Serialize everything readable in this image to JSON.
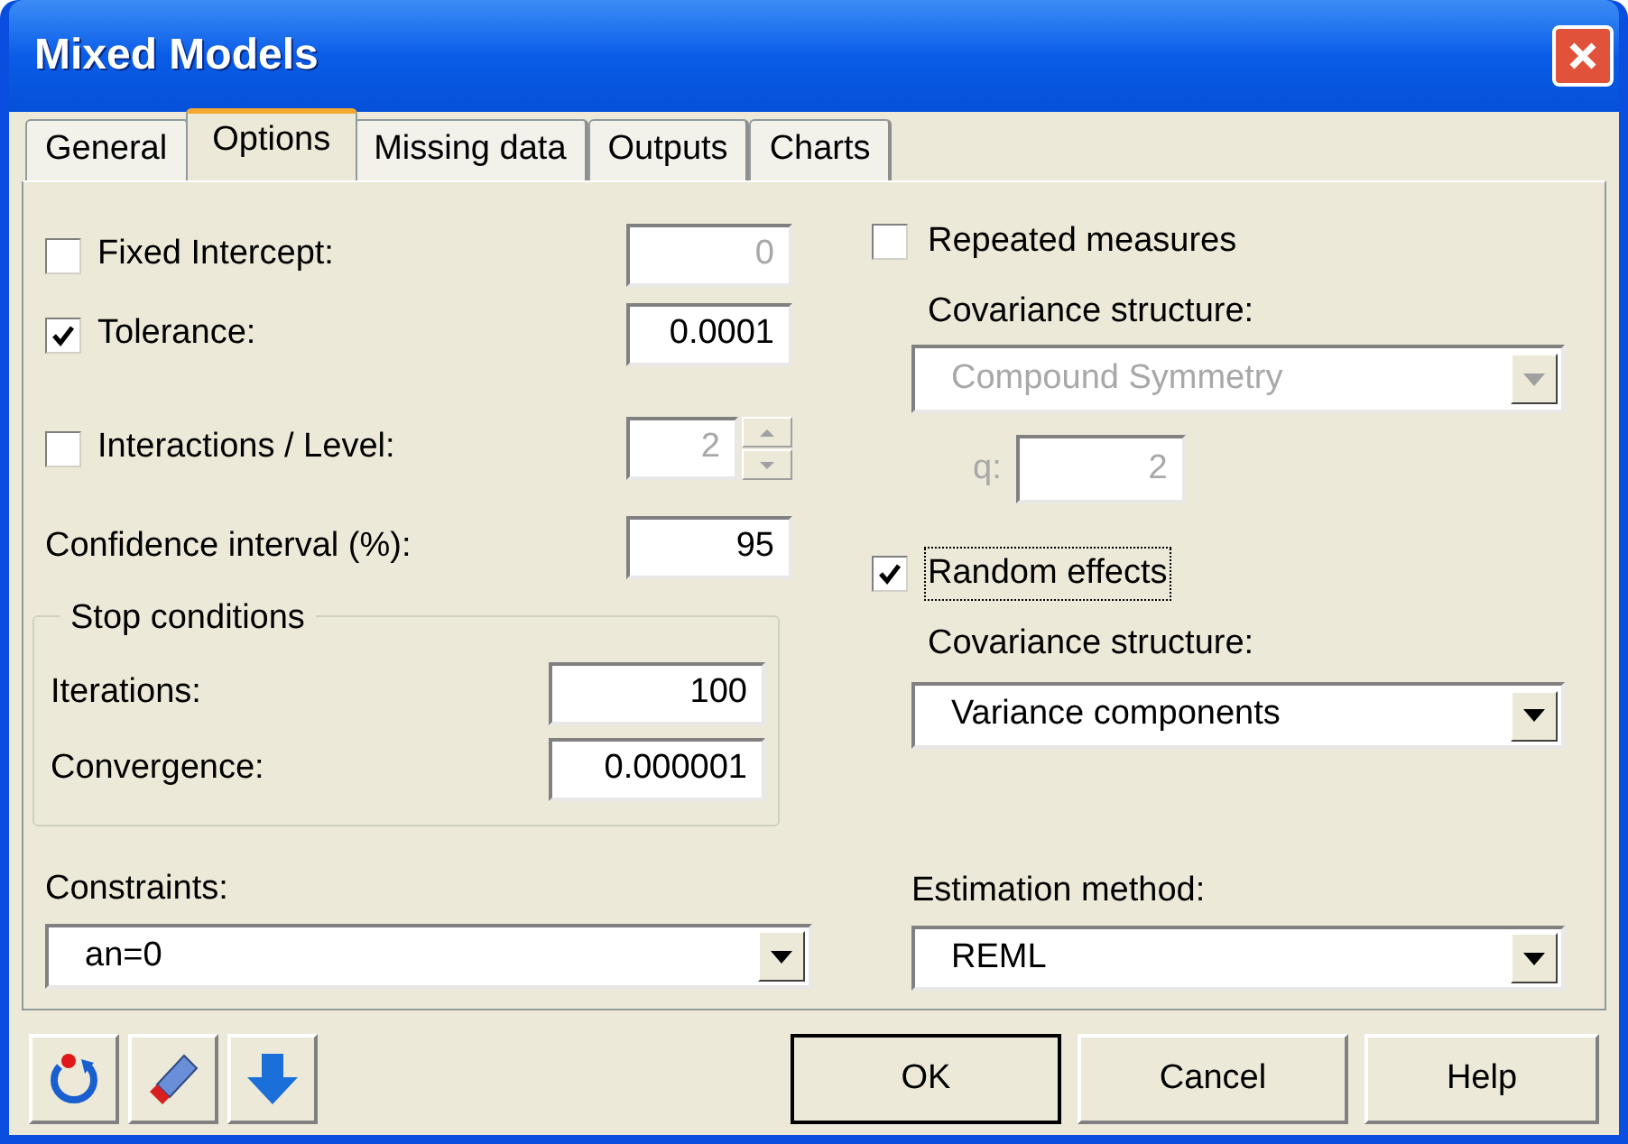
{
  "window": {
    "title": "Mixed Models"
  },
  "tabs": [
    {
      "label": "General",
      "selected": false
    },
    {
      "label": "Options",
      "selected": true
    },
    {
      "label": "Missing data",
      "selected": false
    },
    {
      "label": "Outputs",
      "selected": false
    },
    {
      "label": "Charts",
      "selected": false
    }
  ],
  "fixed_intercept": {
    "label": "Fixed Intercept:",
    "checked": false,
    "value": "0",
    "disabled": true
  },
  "tolerance": {
    "label": "Tolerance:",
    "checked": true,
    "value": "0.0001",
    "disabled": false
  },
  "interactions": {
    "label": "Interactions / Level:",
    "checked": false,
    "value": "2",
    "disabled": true
  },
  "confidence_interval": {
    "label": "Confidence interval (%):",
    "value": "95"
  },
  "stop_conditions": {
    "title": "Stop conditions",
    "iterations": {
      "label": "Iterations:",
      "value": "100"
    },
    "convergence": {
      "label": "Convergence:",
      "value": "0.000001"
    }
  },
  "constraints": {
    "label": "Constraints:",
    "value": "an=0"
  },
  "repeated_measures": {
    "label": "Repeated measures",
    "checked": false,
    "focused": false,
    "covariance_label": "Covariance structure:",
    "structure": {
      "value": "Compound Symmetry",
      "disabled": true
    },
    "q": {
      "label": "q:",
      "value": "2",
      "disabled": true
    }
  },
  "random_effects": {
    "label": "Random effects",
    "checked": true,
    "focused": true,
    "covariance_label": "Covariance structure:",
    "structure": {
      "value": "Variance components",
      "disabled": false
    }
  },
  "estimation_method": {
    "label": "Estimation method:",
    "value": "REML"
  },
  "tool_buttons": [
    {
      "kind": "reset"
    },
    {
      "kind": "eraser"
    },
    {
      "kind": "down"
    }
  ],
  "buttons": [
    {
      "label": "OK",
      "default": true
    },
    {
      "label": "Cancel",
      "default": false
    },
    {
      "label": "Help",
      "default": false
    }
  ]
}
